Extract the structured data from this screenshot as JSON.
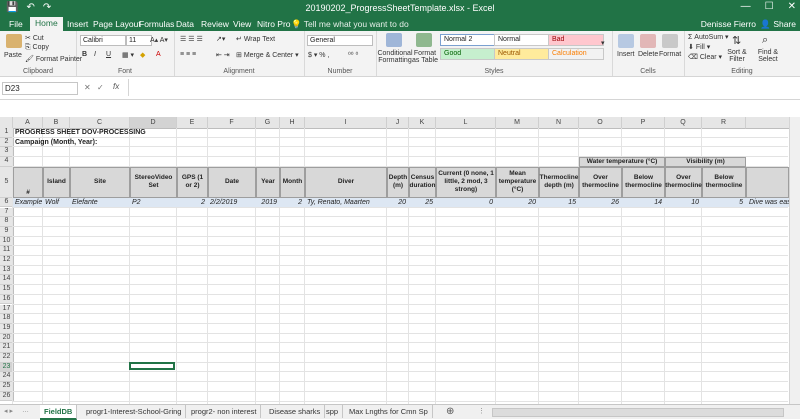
{
  "window": {
    "title": "20190202_ProgressSheetTemplate.xlsx - Excel",
    "user": "Denisse Fierro",
    "share_label": "Share"
  },
  "qat": {
    "save": "💾",
    "undo": "↶",
    "redo": "↷"
  },
  "ribbon_tabs": [
    "File",
    "Home",
    "Insert",
    "Page Layout",
    "Formulas",
    "Data",
    "Review",
    "View",
    "Nitro Pro"
  ],
  "active_tab": "Home",
  "tell_me": "Tell me what you want to do",
  "ribbon": {
    "clipboard": {
      "paste": "Paste",
      "cut": "Cut",
      "copy": "Copy",
      "format_painter": "Format Painter",
      "label": "Clipboard"
    },
    "font": {
      "name": "Calibri",
      "size": "11",
      "bold": "B",
      "italic": "I",
      "underline": "U",
      "label": "Font"
    },
    "alignment": {
      "wrap": "Wrap Text",
      "merge": "Merge & Center",
      "label": "Alignment"
    },
    "number": {
      "format": "General",
      "label": "Number"
    },
    "styles": {
      "conditional": "Conditional Formatting",
      "format_table": "Format as Table",
      "normal2": "Normal 2",
      "normal": "Normal",
      "bad": "Bad",
      "good": "Good",
      "neutral": "Neutral",
      "calculation": "Calculation",
      "label": "Styles"
    },
    "cells": {
      "insert": "Insert",
      "delete": "Delete",
      "format": "Format",
      "label": "Cells"
    },
    "editing": {
      "autosum": "AutoSum",
      "fill": "Fill",
      "clear": "Clear",
      "sort": "Sort & Filter",
      "find": "Find & Select",
      "label": "Editing"
    }
  },
  "formula_bar": {
    "namebox": "D23",
    "fx": "fx",
    "value": ""
  },
  "columns": [
    "A",
    "B",
    "C",
    "D",
    "E",
    "F",
    "G",
    "H",
    "I",
    "J",
    "K",
    "L",
    "M",
    "N",
    "O",
    "P",
    "Q",
    "R"
  ],
  "rows": [
    "1",
    "2",
    "3",
    "4",
    "5",
    "6",
    "7",
    "8",
    "9",
    "10",
    "11",
    "12",
    "13",
    "14",
    "15",
    "16",
    "17",
    "18",
    "19",
    "20",
    "21",
    "22",
    "23",
    "24",
    "25",
    "26"
  ],
  "sheet": {
    "title": "PROGRESS SHEET DOV-PROCESSING",
    "campaign": "Campaign (Month, Year):",
    "group_water": "Water temperature (°C)",
    "group_visibility": "Visibility (m)",
    "headers": [
      "#",
      "Island",
      "Site",
      "StereoVideo Set",
      "GPS (1 or 2)",
      "Date",
      "Year",
      "Month",
      "Diver",
      "Depth (m)",
      "Census duration",
      "Current (0 none, 1 little, 2 mod, 3 strong)",
      "Mean temperature (°C)",
      "Thermocline depth (m)",
      "Over thermocline",
      "Below thermocline",
      "Over thermocline",
      "Below thermocline"
    ],
    "example": [
      "Example",
      "Wolf",
      "Elefante",
      "P2",
      "2",
      "2/2/2019",
      "2019",
      "2",
      "Ty, Renato, Maarten",
      "20",
      "25",
      "0",
      "20",
      "15",
      "26",
      "14",
      "10",
      "5",
      "Dive was easy,"
    ]
  },
  "sheet_tabs": [
    "FieldDB",
    "progr1-Interest-School-Gring",
    "progr2- non interest",
    "Disease sharks",
    "spp",
    "Max Lngths for Cmn Sp"
  ],
  "active_sheet": "FieldDB"
}
